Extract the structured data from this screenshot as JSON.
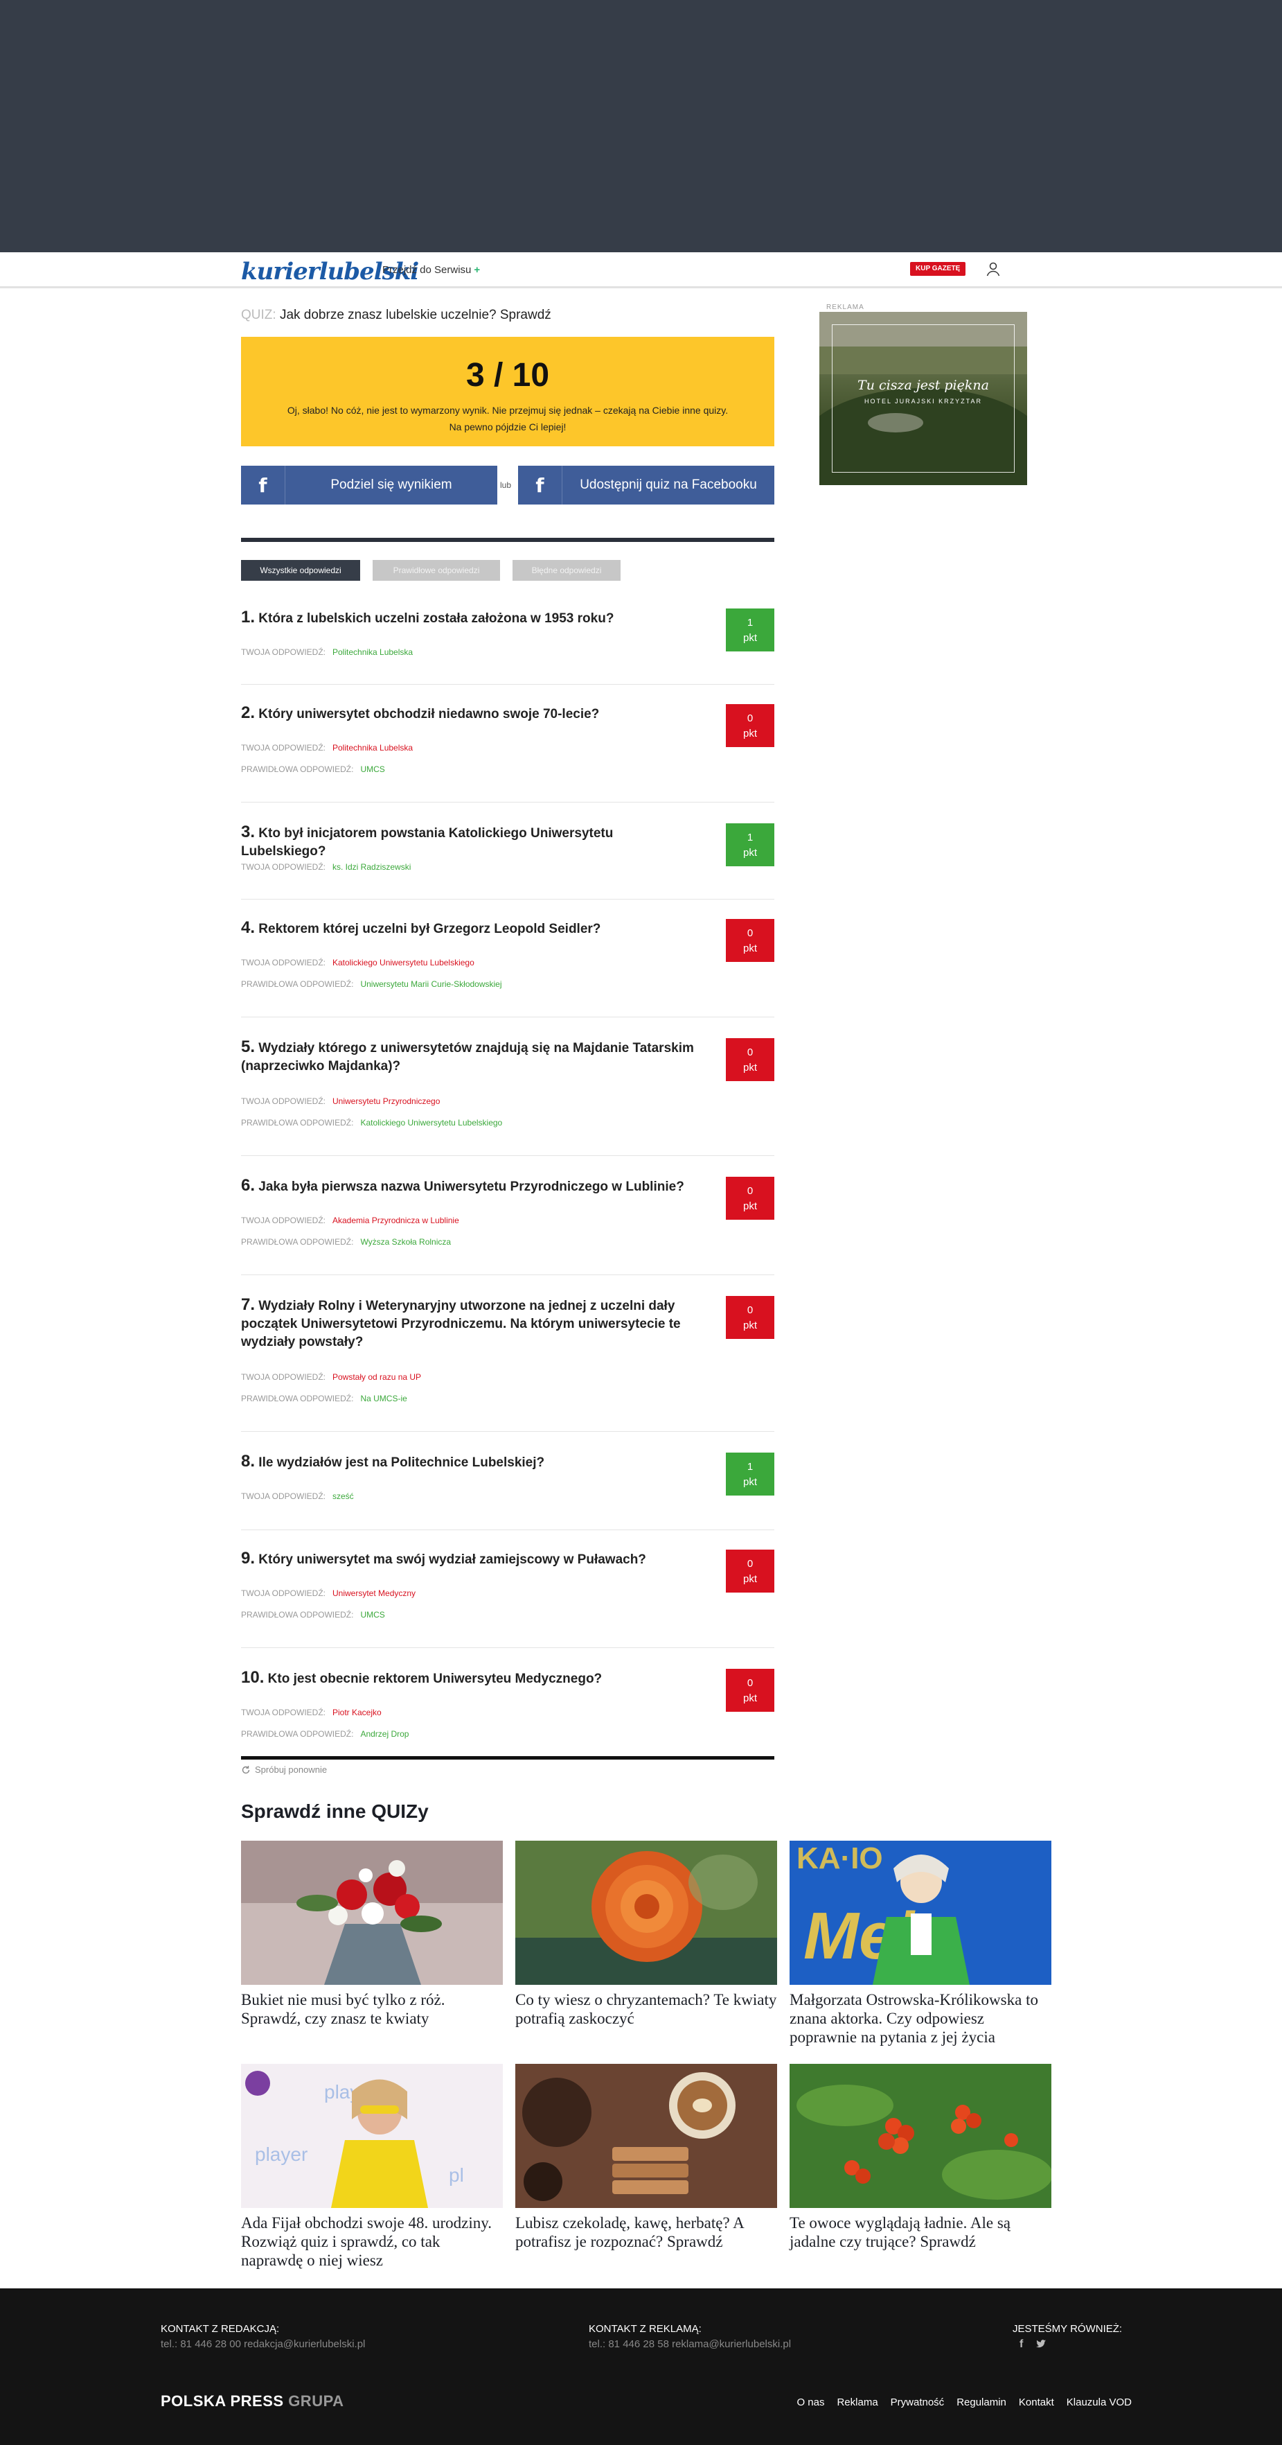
{
  "navbar": {
    "logo": "kurierlubelski",
    "service_link": "Przejdź do Serwisu",
    "service_plus": "+",
    "buy_paper": "KUP GAZETĘ"
  },
  "quiz": {
    "title_prefix": "QUIZ:",
    "title": "Jak dobrze znasz lubelskie uczelnie? Sprawdź",
    "score": "3 / 10",
    "message_line1": "Oj, słabo! No cóż, nie jest to wymarzony wynik. Nie przejmuj się jednak – czekają na Ciebie inne quizy.",
    "message_line2": "Na pewno pójdzie Ci lepiej!",
    "share_results": "Podziel się wynikiem",
    "or": "lub",
    "share_quiz": "Udostępnij quiz na Facebooku"
  },
  "filters": {
    "all": "Wszystkie odpowiedzi",
    "correct": "Prawidłowe odpowiedzi",
    "wrong": "Błędne odpowiedzi"
  },
  "labels": {
    "your_answer": "TWOJA ODPOWIEDŹ:",
    "correct_answer": "PRAWIDŁOWA ODPOWIEDŹ:",
    "pkt": "pkt"
  },
  "questions": [
    {
      "num": "1.",
      "text": "Która z lubelskich uczelni została założona w 1953 roku?",
      "points": "1",
      "your": "Politechnika Lubelska",
      "correct": ""
    },
    {
      "num": "2.",
      "text": "Który uniwersytet obchodził niedawno swoje 70-lecie?",
      "points": "0",
      "your": "Politechnika Lubelska",
      "correct": "UMCS"
    },
    {
      "num": "3.",
      "text": "Kto był inicjatorem powstania Katolickiego Uniwersytetu Lubelskiego?",
      "points": "1",
      "your": "ks. Idzi Radziszewski",
      "correct": ""
    },
    {
      "num": "4.",
      "text": "Rektorem której uczelni był Grzegorz Leopold Seidler?",
      "points": "0",
      "your": "Katolickiego Uniwersytetu Lubelskiego",
      "correct": "Uniwersytetu Marii Curie-Skłodowskiej"
    },
    {
      "num": "5.",
      "text": "Wydziały którego z uniwersytetów znajdują się na Majdanie Tatarskim (naprzeciwko Majdanka)?",
      "points": "0",
      "your": "Uniwersytetu Przyrodniczego",
      "correct": "Katolickiego Uniwersytetu Lubelskiego"
    },
    {
      "num": "6.",
      "text": "Jaka była pierwsza nazwa Uniwersytetu Przyrodniczego w Lublinie?",
      "points": "0",
      "your": "Akademia Przyrodnicza w Lublinie",
      "correct": "Wyższa Szkoła Rolnicza"
    },
    {
      "num": "7.",
      "text": "Wydziały Rolny i Weterynaryjny utworzone na jednej z uczelni dały początek Uniwersytetowi Przyrodniczemu. Na którym uniwersytecie te wydziały powstały?",
      "points": "0",
      "your": "Powstały od razu na UP",
      "correct": "Na UMCS-ie"
    },
    {
      "num": "8.",
      "text": "Ile wydziałów jest na Politechnice Lubelskiej?",
      "points": "1",
      "your": "sześć",
      "correct": ""
    },
    {
      "num": "9.",
      "text": "Który uniwersytet ma swój wydział zamiejscowy w Puławach?",
      "points": "0",
      "your": "Uniwersytet Medyczny",
      "correct": "UMCS"
    },
    {
      "num": "10.",
      "text": "Kto jest obecnie rektorem Uniwersyteu Medycznego?",
      "points": "0",
      "your": "Piotr Kacejko",
      "correct": "Andrzej Drop"
    }
  ],
  "retry": "Spróbuj ponownie",
  "more_quizzes": {
    "title": "Sprawdź inne QUIZy",
    "cards": [
      {
        "caption": "Bukiet nie musi być tylko z róż. Sprawdź, czy znasz te kwiaty"
      },
      {
        "caption": "Co ty wiesz o chryzantemach? Te kwiaty potrafią zaskoczyć"
      },
      {
        "caption": "Małgorzata Ostrowska-Królikowska to znana aktorka. Czy odpowiesz poprawnie na pytania z jej życia"
      },
      {
        "caption": "Ada Fijał obchodzi swoje 48. urodziny. Rozwiąż quiz i sprawdź, co tak naprawdę o niej wiesz"
      },
      {
        "caption": "Lubisz czekoladę, kawę, herbatę? A potrafisz je rozpoznać? Sprawdź"
      },
      {
        "caption": "Te owoce wyglądają ładnie. Ale są jadalne czy trujące? Sprawdź"
      }
    ]
  },
  "ad": {
    "label": "REKLAMA",
    "headline": "Tu cisza jest piękna",
    "subline": "HOTEL JURAJSKI KRZYZTAR"
  },
  "footer": {
    "contact_editorial_title": "KONTAKT Z REDAKCJĄ:",
    "contact_editorial": "tel.: 81 446 28 00 redakcja@kurierlubelski.pl",
    "contact_ads_title": "KONTAKT Z REKLAMĄ:",
    "contact_ads": "tel.: 81 446 28 58 reklama@kurierlubelski.pl",
    "social_title": "JESTEŚMY RÓWNIEŻ:",
    "brand": "POLSKA PRESS",
    "brand_suffix": "GRUPA",
    "links": [
      "O nas",
      "Reklama",
      "Prywatność",
      "Regulamin",
      "Kontakt",
      "Klauzula VOD"
    ]
  },
  "colors": {
    "accent_yellow": "#fdc62a",
    "facebook": "#3f5d99",
    "correct": "#3ba83b",
    "wrong": "#d8111f",
    "dark": "#363d48"
  }
}
